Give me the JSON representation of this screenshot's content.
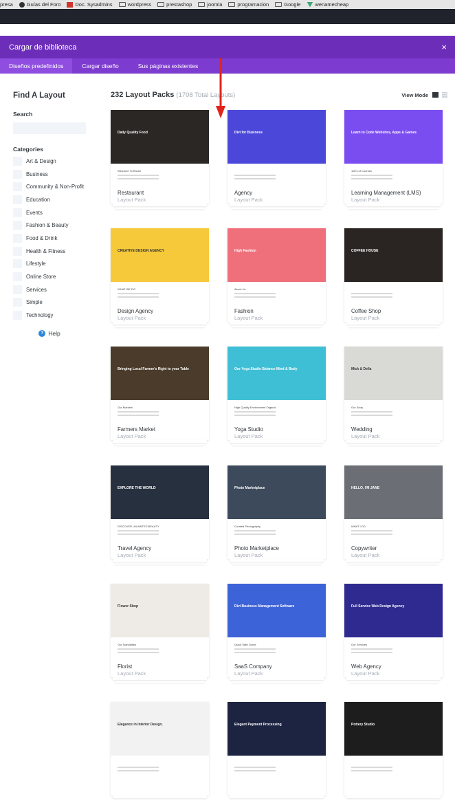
{
  "bookmarks": [
    {
      "label": "presa",
      "icon": "none"
    },
    {
      "label": "Guías del Foro",
      "icon": "site-icon"
    },
    {
      "label": "Doc. Sysadmins",
      "icon": "doc-icon"
    },
    {
      "label": "wordpress",
      "icon": "folder-icon"
    },
    {
      "label": "prestashop",
      "icon": "folder-icon"
    },
    {
      "label": "joomla",
      "icon": "folder-icon"
    },
    {
      "label": "programacion",
      "icon": "folder-icon"
    },
    {
      "label": "Google",
      "icon": "folder-icon"
    },
    {
      "label": "wenamecheap",
      "icon": "vue-icon"
    }
  ],
  "modal": {
    "title": "Cargar de biblioteca",
    "close": "×",
    "tabs": [
      "Diseños predefinidos",
      "Cargar diseño",
      "Sus páginas existentes"
    ]
  },
  "sidebar": {
    "heading": "Find A Layout",
    "search_label": "Search",
    "search_placeholder": "",
    "categories_label": "Categories",
    "categories": [
      "Art & Design",
      "Business",
      "Community & Non-Profit",
      "Education",
      "Events",
      "Fashion & Beauty",
      "Food & Drink",
      "Health & Fitness",
      "Lifestyle",
      "Online Store",
      "Services",
      "Simple",
      "Technology"
    ],
    "help": "Help"
  },
  "main": {
    "count_title": "232 Layout Packs",
    "count_sub": "(1708 Total Layouts)",
    "view_mode": "View Mode"
  },
  "cards": [
    {
      "name": "Restaurant",
      "sub": "Layout Pack",
      "hero": "#2b2724",
      "text": "Daily Quality Food",
      "lower": "Welcome To Bread"
    },
    {
      "name": "Agency",
      "sub": "Layout Pack",
      "hero": "#4b48d9",
      "text": "Divi for Business",
      "lower": ""
    },
    {
      "name": "Learning Management (LMS)",
      "sub": "Layout Pack",
      "hero": "#7a4df0",
      "text": "Learn to Code Websites, Apps & Games",
      "lower": "100's of Courses"
    },
    {
      "name": "Design Agency",
      "sub": "Layout Pack",
      "hero": "#f5c93a",
      "text": "CREATIVE DESIGN AGENCY",
      "lower": "WHAT WE DO"
    },
    {
      "name": "Fashion",
      "sub": "Layout Pack",
      "hero": "#ef6f7b",
      "text": "High Fashion",
      "lower": "About Us"
    },
    {
      "name": "Coffee Shop",
      "sub": "Layout Pack",
      "hero": "#2a2522",
      "text": "COFFEE HOUSE",
      "lower": ""
    },
    {
      "name": "Farmers Market",
      "sub": "Layout Pack",
      "hero": "#4a3b2a",
      "text": "Bringing Local Farmer's Right to your Table",
      "lower": "Our Markets"
    },
    {
      "name": "Yoga Studio",
      "sub": "Layout Pack",
      "hero": "#3fbfd6",
      "text": "Our Yoga Studio Balance Mind & Body",
      "lower": "High Quality Environment Organic"
    },
    {
      "name": "Wedding",
      "sub": "Layout Pack",
      "hero": "#d9d9d6",
      "text": "Mick & Della",
      "lower": "Our Story"
    },
    {
      "name": "Travel Agency",
      "sub": "Layout Pack",
      "hero": "#27303f",
      "text": "EXPLORE THE WORLD",
      "lower": "DISCOVER UNLIMITED BEAUTY"
    },
    {
      "name": "Photo Marketplace",
      "sub": "Layout Pack",
      "hero": "#3c4a5c",
      "text": "Photo Marketplace",
      "lower": "Curated Photography"
    },
    {
      "name": "Copywriter",
      "sub": "Layout Pack",
      "hero": "#6b6f75",
      "text": "HELLO, I'M JANE",
      "lower": "WHAT I DO"
    },
    {
      "name": "Florist",
      "sub": "Layout Pack",
      "hero": "#eeeae6",
      "text": "Flower Shop",
      "lower": "Our Specialties"
    },
    {
      "name": "SaaS Company",
      "sub": "Layout Pack",
      "hero": "#3d63d8",
      "text": "Divi Business Management Software",
      "lower": "Quick Start Guide"
    },
    {
      "name": "Web Agency",
      "sub": "Layout Pack",
      "hero": "#2e2a8f",
      "text": "Full Service Web Design Agency",
      "lower": "Our Services"
    },
    {
      "name": "",
      "sub": "",
      "hero": "#f2f2f2",
      "text": "Elegance in Interior Design.",
      "lower": ""
    },
    {
      "name": "",
      "sub": "",
      "hero": "#1d2442",
      "text": "Elegant Payment Processing",
      "lower": ""
    },
    {
      "name": "",
      "sub": "",
      "hero": "#1d1d1d",
      "text": "Pottery Studio",
      "lower": ""
    }
  ],
  "colors": {
    "purple_header": "#6c2eb9",
    "purple_tabs": "#7e3bd0",
    "arrow": "#e0241b"
  }
}
